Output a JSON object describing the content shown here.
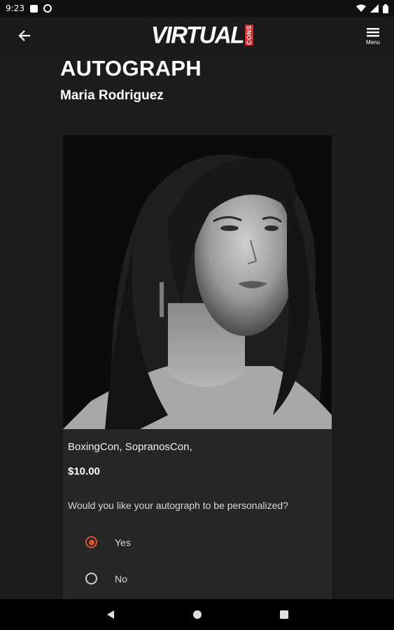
{
  "status_bar": {
    "time": "9:23"
  },
  "app_bar": {
    "logo_main": "VIRTUAL",
    "logo_tag": "CONS",
    "menu_label": "Menu"
  },
  "page": {
    "title": "AUTOGRAPH",
    "celebrity_name": "Maria Rodriguez"
  },
  "product": {
    "cons": "BoxingCon,  SopranosCon,",
    "price": "$10.00",
    "question": "Would you like your autograph to be personalized?",
    "options": [
      {
        "label": "Yes",
        "selected": true
      },
      {
        "label": "No",
        "selected": false
      }
    ]
  },
  "colors": {
    "accent": "#d9502e",
    "brand_red": "#d9262a",
    "background": "#1c1c1c",
    "card": "#262626"
  }
}
